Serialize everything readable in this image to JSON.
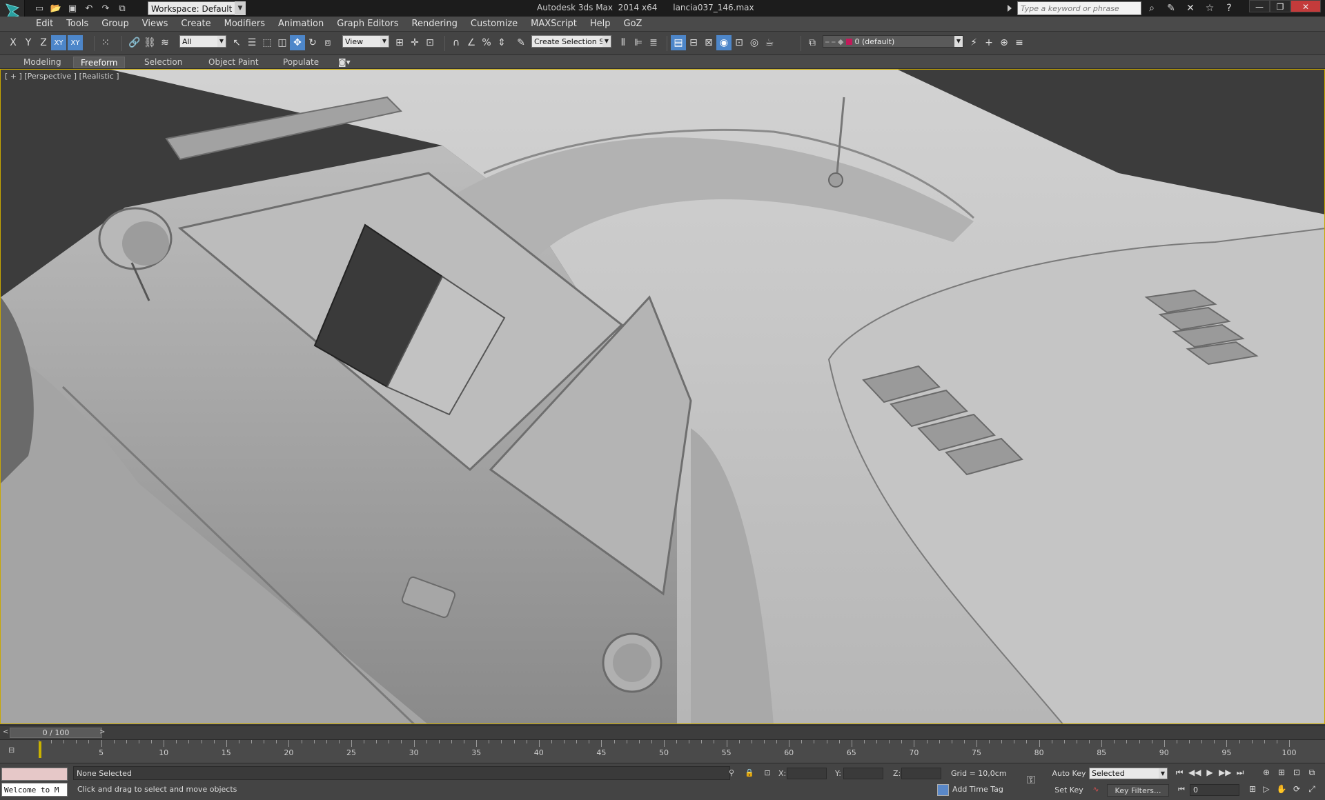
{
  "title_bar": {
    "workspace_label": "Workspace: Default",
    "title": "Autodesk 3ds Max  2014 x64      lancia037_146.max",
    "search_placeholder": "Type a keyword or phrase"
  },
  "menu": [
    "Edit",
    "Tools",
    "Group",
    "Views",
    "Create",
    "Modifiers",
    "Animation",
    "Graph Editors",
    "Rendering",
    "Customize",
    "MAXScript",
    "Help",
    "GoZ"
  ],
  "toolbar": {
    "axis_x": "X",
    "axis_y": "Y",
    "axis_z": "Z",
    "axis_xy": "XY",
    "axis_xy2": "XY",
    "filter_value": "All",
    "ref_coord_value": "View",
    "selection_set_value": "Create Selection Se",
    "layer_value": "0 (default)"
  },
  "ribbon": {
    "tabs": [
      "Modeling",
      "Freeform",
      "Selection",
      "Object Paint",
      "Populate"
    ],
    "active_tab": "Freeform"
  },
  "viewport": {
    "label": "[ + ] [Perspective ] [Realistic ]"
  },
  "timeline": {
    "frame_display": "0 / 100",
    "ticks": [
      "5",
      "10",
      "15",
      "20",
      "25",
      "30",
      "35",
      "40",
      "45",
      "50",
      "55",
      "60",
      "65",
      "70",
      "75",
      "80",
      "85",
      "90",
      "95",
      "100"
    ]
  },
  "status": {
    "welcome": "Welcome to M",
    "selection": "None Selected",
    "prompt": "Click and drag to select and move objects",
    "x_label": "X:",
    "y_label": "Y:",
    "z_label": "Z:",
    "grid": "Grid = 10,0cm",
    "add_time_tag": "Add Time Tag",
    "auto_key": "Auto Key",
    "set_key": "Set Key",
    "key_mode_value": "Selected",
    "key_filters": "Key Filters...",
    "current_frame": "0"
  }
}
